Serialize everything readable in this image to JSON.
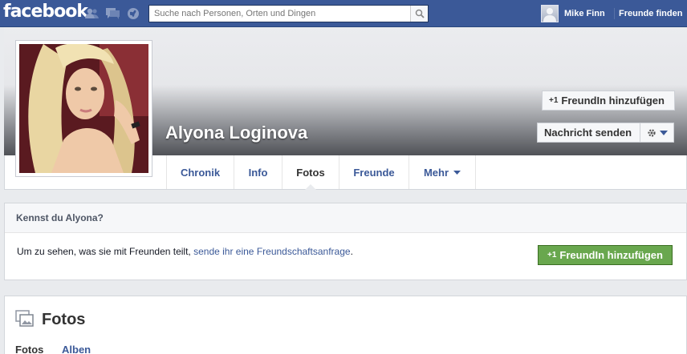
{
  "topbar": {
    "logo": "facebook",
    "search_placeholder": "Suche nach Personen, Orten und Dingen",
    "user_name": "Mike Finn",
    "find_friends": "Freunde finden",
    "bg_color": "#3b5998"
  },
  "profile": {
    "name": "Alyona Loginova",
    "add_friend_label": "FreundIn hinzufügen",
    "add_friend_badge": "+1",
    "message_label": "Nachricht senden"
  },
  "tabs": [
    {
      "label": "Chronik"
    },
    {
      "label": "Info"
    },
    {
      "label": "Fotos",
      "active": true
    },
    {
      "label": "Freunde"
    },
    {
      "label": "Mehr"
    }
  ],
  "know_box": {
    "heading": "Kennst du Alyona?",
    "text": "Um zu sehen, was sie mit Freunden teilt, ",
    "link": "sende ihr eine Freundschaftsanfrage",
    "text_end": ".",
    "button_label": "FreundIn hinzufügen",
    "button_badge": "+1",
    "button_color": "#69a74e"
  },
  "photos_box": {
    "title": "Fotos",
    "subtabs": [
      {
        "label": "Fotos",
        "active": true
      },
      {
        "label": "Alben"
      }
    ]
  },
  "icons": [
    "friend-requests-icon",
    "messages-icon",
    "notifications-icon",
    "search-icon",
    "gear-icon",
    "caret-down-icon",
    "photos-icon"
  ]
}
